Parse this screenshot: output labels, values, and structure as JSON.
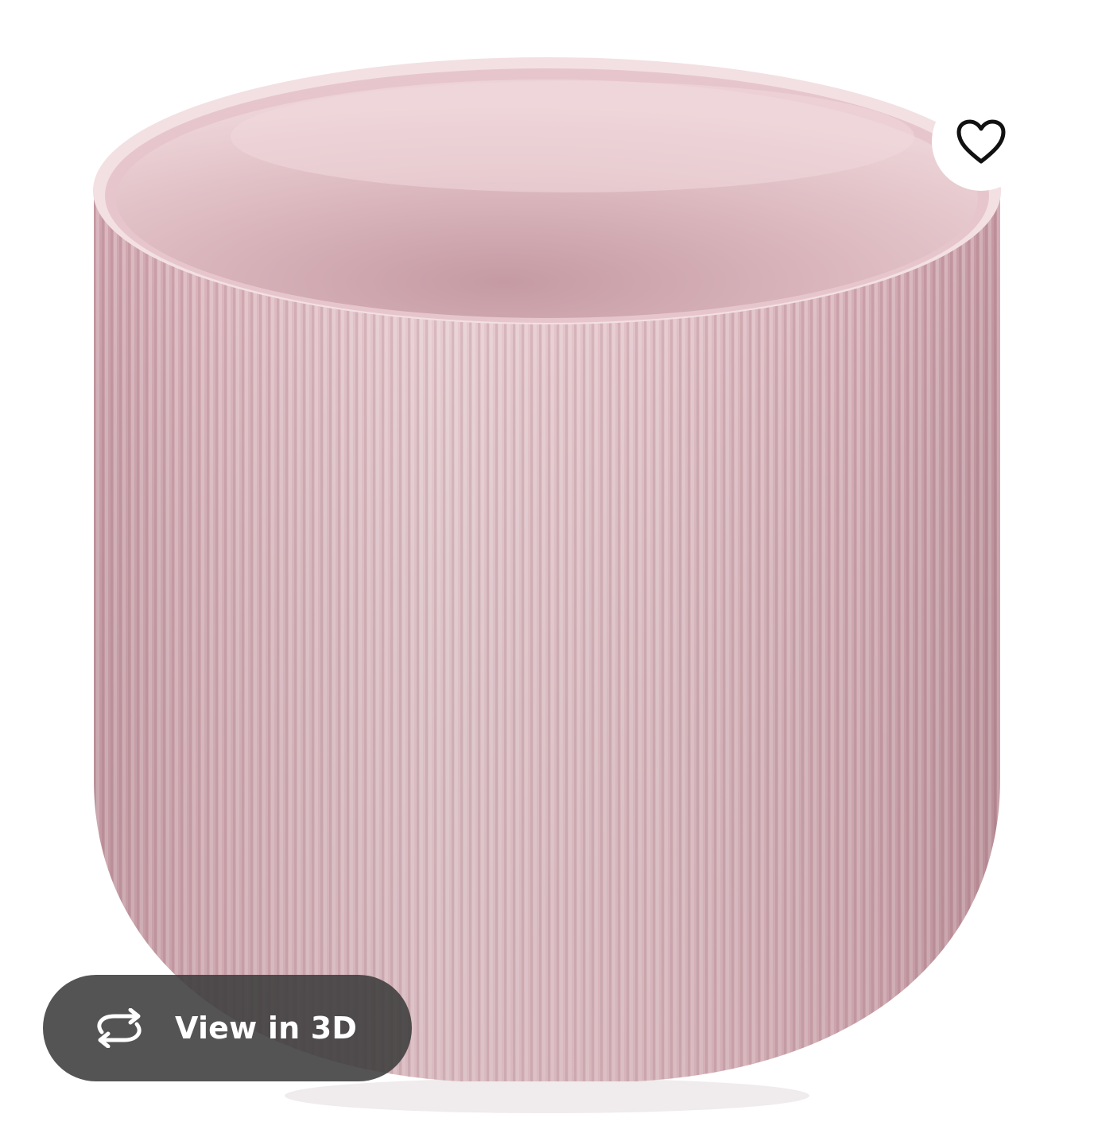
{
  "product_image": {
    "icon": "ribbed-plant-pot",
    "color": "#e3bfc6"
  },
  "favourite": {
    "icon": "heart-icon"
  },
  "view_3d": {
    "icon": "rotate-arrows-icon",
    "label": "View in 3D"
  },
  "colors": {
    "page_background": "#ffffff",
    "pill_background": "#3c3c3c",
    "pill_text": "#ffffff",
    "heart_stroke": "#111111"
  }
}
